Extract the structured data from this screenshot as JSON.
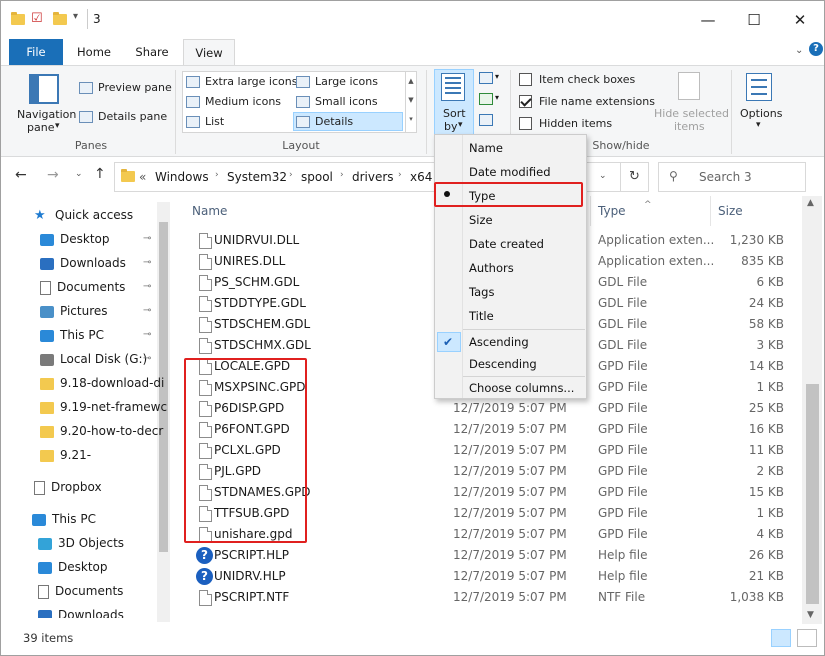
{
  "window": {
    "title": "3",
    "minimize_glyph": "—",
    "maximize_glyph": "☐",
    "close_glyph": "✕"
  },
  "tabs": [
    {
      "label": "File"
    },
    {
      "label": "Home"
    },
    {
      "label": "Share"
    },
    {
      "label": "View"
    }
  ],
  "ribbon": {
    "panes": {
      "navigation_pane": "Navigation",
      "navigation_pane_2": "pane",
      "preview_pane": "Preview pane",
      "details_pane": "Details pane",
      "group_label": "Panes"
    },
    "layout": {
      "extra_large_icons": "Extra large icons",
      "large_icons": "Large icons",
      "medium_icons": "Medium icons",
      "small_icons": "Small icons",
      "list": "List",
      "details": "Details",
      "group_label": "Layout"
    },
    "current_view": {
      "sort_by": "Sort",
      "sort_by_2": "by"
    },
    "show_hide": {
      "item_check_boxes": "Item check boxes",
      "item_check_boxes_checked": false,
      "file_name_extensions": "File name extensions",
      "file_name_extensions_checked": true,
      "hidden_items": "Hidden items",
      "hidden_items_checked": false,
      "hide_selected_items": "Hide selected",
      "hide_selected_items_2": "items",
      "group_label": "Show/hide"
    },
    "options": {
      "label": "Options"
    }
  },
  "address": {
    "breadcrumb": [
      "«",
      "Windows",
      "System32",
      "spool",
      "drivers",
      "x64"
    ],
    "search_placeholder": "Search 3"
  },
  "nav": {
    "items": [
      {
        "label": "Quick access",
        "icon": "star-icon"
      },
      {
        "label": "Desktop",
        "icon": "desktop-icon",
        "pinned": true
      },
      {
        "label": "Downloads",
        "icon": "download-icon",
        "pinned": true
      },
      {
        "label": "Documents",
        "icon": "documents-icon",
        "pinned": true
      },
      {
        "label": "Pictures",
        "icon": "pictures-icon",
        "pinned": true
      },
      {
        "label": "This PC",
        "icon": "pc-icon",
        "pinned": true
      },
      {
        "label": "Local Disk (G:)",
        "icon": "drive-icon",
        "pinned": true
      },
      {
        "label": "9.18-download-di",
        "icon": "folder-icon"
      },
      {
        "label": "9.19-net-framewc",
        "icon": "folder-icon"
      },
      {
        "label": "9.20-how-to-decr",
        "icon": "folder-icon"
      },
      {
        "label": "9.21-",
        "icon": "folder-icon"
      },
      {
        "label": "Dropbox",
        "icon": "dropbox-icon"
      },
      {
        "label": "This PC",
        "icon": "pc-icon"
      },
      {
        "label": "3D Objects",
        "icon": "cube-icon"
      },
      {
        "label": "Desktop",
        "icon": "desktop-icon"
      },
      {
        "label": "Documents",
        "icon": "documents-icon"
      },
      {
        "label": "Downloads",
        "icon": "download-icon"
      }
    ],
    "pin_glyph": "📌"
  },
  "columns": {
    "name": "Name",
    "type": "Type",
    "size": "Size"
  },
  "files": [
    {
      "name": "UNIDRVUI.DLL",
      "date": "",
      "type": "Application exten...",
      "size": "1,230 KB",
      "icon": "file-icon"
    },
    {
      "name": "UNIRES.DLL",
      "date": "",
      "type": "Application exten...",
      "size": "835 KB",
      "icon": "file-icon"
    },
    {
      "name": "PS_SCHM.GDL",
      "date": "",
      "type": "GDL File",
      "size": "6 KB",
      "icon": "file-icon"
    },
    {
      "name": "STDDTYPE.GDL",
      "date": "",
      "type": "GDL File",
      "size": "24 KB",
      "icon": "file-icon"
    },
    {
      "name": "STDSCHEM.GDL",
      "date": "",
      "type": "GDL File",
      "size": "58 KB",
      "icon": "file-icon"
    },
    {
      "name": "STDSCHMX.GDL",
      "date": "",
      "type": "GDL File",
      "size": "3 KB",
      "icon": "file-icon"
    },
    {
      "name": "LOCALE.GPD",
      "date": "",
      "type": "GPD File",
      "size": "14 KB",
      "icon": "file-icon"
    },
    {
      "name": "MSXPSINC.GPD",
      "date": "",
      "type": "GPD File",
      "size": "1 KB",
      "icon": "file-icon"
    },
    {
      "name": "P6DISP.GPD",
      "date": "12/7/2019 5:07 PM",
      "type": "GPD File",
      "size": "25 KB",
      "icon": "file-icon"
    },
    {
      "name": "P6FONT.GPD",
      "date": "12/7/2019 5:07 PM",
      "type": "GPD File",
      "size": "16 KB",
      "icon": "file-icon"
    },
    {
      "name": "PCLXL.GPD",
      "date": "12/7/2019 5:07 PM",
      "type": "GPD File",
      "size": "11 KB",
      "icon": "file-icon"
    },
    {
      "name": "PJL.GPD",
      "date": "12/7/2019 5:07 PM",
      "type": "GPD File",
      "size": "2 KB",
      "icon": "file-icon"
    },
    {
      "name": "STDNAMES.GPD",
      "date": "12/7/2019 5:07 PM",
      "type": "GPD File",
      "size": "15 KB",
      "icon": "file-icon"
    },
    {
      "name": "TTFSUB.GPD",
      "date": "12/7/2019 5:07 PM",
      "type": "GPD File",
      "size": "1 KB",
      "icon": "file-icon"
    },
    {
      "name": "unishare.gpd",
      "date": "12/7/2019 5:07 PM",
      "type": "GPD File",
      "size": "4 KB",
      "icon": "file-icon"
    },
    {
      "name": "PSCRIPT.HLP",
      "date": "12/7/2019 5:07 PM",
      "type": "Help file",
      "size": "26 KB",
      "icon": "help-icon"
    },
    {
      "name": "UNIDRV.HLP",
      "date": "12/7/2019 5:07 PM",
      "type": "Help file",
      "size": "21 KB",
      "icon": "help-icon"
    },
    {
      "name": "PSCRIPT.NTF",
      "date": "12/7/2019 5:07 PM",
      "type": "NTF File",
      "size": "1,038 KB",
      "icon": "file-icon"
    }
  ],
  "sort_menu": {
    "items": [
      "Name",
      "Date modified",
      "Type",
      "Size",
      "Date created",
      "Authors",
      "Tags",
      "Title"
    ],
    "selected": "Type",
    "order": [
      "Ascending",
      "Descending"
    ],
    "order_selected": "Ascending",
    "choose_columns": "Choose columns..."
  },
  "status": {
    "item_count": "39 items"
  },
  "colors": {
    "file_tab": "#1a6fb8",
    "highlight": "#e0201f",
    "selected_bg": "#cce8ff"
  }
}
